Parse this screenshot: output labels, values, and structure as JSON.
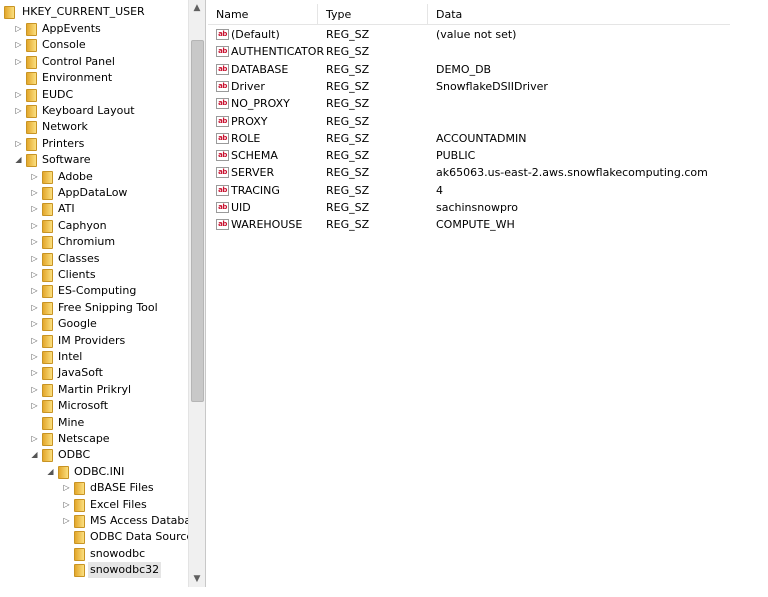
{
  "tree": {
    "root_label": "HKEY_CURRENT_USER",
    "items": [
      {
        "label": "AppEvents",
        "level": 1,
        "expander": "▷"
      },
      {
        "label": "Console",
        "level": 1,
        "expander": "▷"
      },
      {
        "label": "Control Panel",
        "level": 1,
        "expander": "▷"
      },
      {
        "label": "Environment",
        "level": 1,
        "expander": ""
      },
      {
        "label": "EUDC",
        "level": 1,
        "expander": "▷"
      },
      {
        "label": "Keyboard Layout",
        "level": 1,
        "expander": "▷"
      },
      {
        "label": "Network",
        "level": 1,
        "expander": ""
      },
      {
        "label": "Printers",
        "level": 1,
        "expander": "▷"
      },
      {
        "label": "Software",
        "level": 1,
        "expander": "◢"
      },
      {
        "label": "Adobe",
        "level": 2,
        "expander": "▷"
      },
      {
        "label": "AppDataLow",
        "level": 2,
        "expander": "▷"
      },
      {
        "label": "ATI",
        "level": 2,
        "expander": "▷"
      },
      {
        "label": "Caphyon",
        "level": 2,
        "expander": "▷"
      },
      {
        "label": "Chromium",
        "level": 2,
        "expander": "▷"
      },
      {
        "label": "Classes",
        "level": 2,
        "expander": "▷"
      },
      {
        "label": "Clients",
        "level": 2,
        "expander": "▷"
      },
      {
        "label": "ES-Computing",
        "level": 2,
        "expander": "▷"
      },
      {
        "label": "Free Snipping Tool",
        "level": 2,
        "expander": "▷"
      },
      {
        "label": "Google",
        "level": 2,
        "expander": "▷"
      },
      {
        "label": "IM Providers",
        "level": 2,
        "expander": "▷"
      },
      {
        "label": "Intel",
        "level": 2,
        "expander": "▷"
      },
      {
        "label": "JavaSoft",
        "level": 2,
        "expander": "▷"
      },
      {
        "label": "Martin Prikryl",
        "level": 2,
        "expander": "▷"
      },
      {
        "label": "Microsoft",
        "level": 2,
        "expander": "▷"
      },
      {
        "label": "Mine",
        "level": 2,
        "expander": ""
      },
      {
        "label": "Netscape",
        "level": 2,
        "expander": "▷"
      },
      {
        "label": "ODBC",
        "level": 2,
        "expander": "◢"
      },
      {
        "label": "ODBC.INI",
        "level": 3,
        "expander": "◢"
      },
      {
        "label": "dBASE Files",
        "level": 4,
        "expander": "▷"
      },
      {
        "label": "Excel Files",
        "level": 4,
        "expander": "▷"
      },
      {
        "label": "MS Access Databas",
        "level": 4,
        "expander": "▷"
      },
      {
        "label": "ODBC Data Sources",
        "level": 4,
        "expander": ""
      },
      {
        "label": "snowodbc",
        "level": 4,
        "expander": ""
      },
      {
        "label": "snowodbc32",
        "level": 4,
        "expander": "",
        "selected": true
      }
    ]
  },
  "values": {
    "columns": {
      "name": "Name",
      "type": "Type",
      "data": "Data"
    },
    "rows": [
      {
        "name": "(Default)",
        "type": "REG_SZ",
        "data": "(value not set)"
      },
      {
        "name": "AUTHENTICATOR",
        "type": "REG_SZ",
        "data": ""
      },
      {
        "name": "DATABASE",
        "type": "REG_SZ",
        "data": "DEMO_DB"
      },
      {
        "name": "Driver",
        "type": "REG_SZ",
        "data": "SnowflakeDSIIDriver"
      },
      {
        "name": "NO_PROXY",
        "type": "REG_SZ",
        "data": ""
      },
      {
        "name": "PROXY",
        "type": "REG_SZ",
        "data": ""
      },
      {
        "name": "ROLE",
        "type": "REG_SZ",
        "data": "ACCOUNTADMIN"
      },
      {
        "name": "SCHEMA",
        "type": "REG_SZ",
        "data": "PUBLIC"
      },
      {
        "name": "SERVER",
        "type": "REG_SZ",
        "data": "ak65063.us-east-2.aws.snowflakecomputing.com"
      },
      {
        "name": "TRACING",
        "type": "REG_SZ",
        "data": "4"
      },
      {
        "name": "UID",
        "type": "REG_SZ",
        "data": "sachinsnowpro"
      },
      {
        "name": "WAREHOUSE",
        "type": "REG_SZ",
        "data": "COMPUTE_WH"
      }
    ],
    "value_icon_text": "ab"
  },
  "icons": {
    "folder": "folder-icon",
    "value": "reg-sz-icon",
    "expand": "expand-arrow-icon",
    "collapse": "collapse-arrow-icon"
  },
  "colors": {
    "folder_fill": "#e9b43a",
    "icon_red": "#c8102e",
    "selected_bg": "#e5e5e5"
  }
}
